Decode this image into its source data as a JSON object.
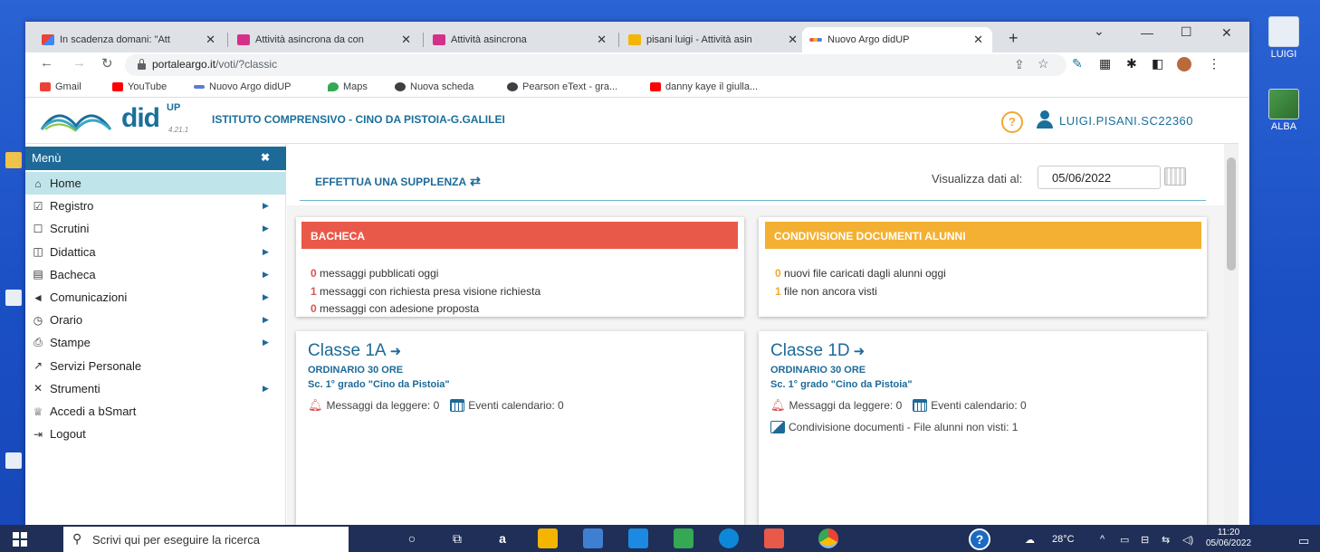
{
  "desktop": {
    "icons": [
      {
        "label": "LUIGI"
      },
      {
        "label": "ALBA"
      }
    ]
  },
  "browser": {
    "tabs": [
      {
        "title": "In scadenza domani: \"Att",
        "favicon_color": "#ea4335"
      },
      {
        "title": "Attività asincrona da con",
        "favicon_color": "#d62f8a"
      },
      {
        "title": "Attività asincrona",
        "favicon_color": "#d62f8a"
      },
      {
        "title": "pisani luigi - Attività asin",
        "favicon_color": "#f4b400"
      },
      {
        "title": "Nuovo Argo didUP",
        "favicon_color": "#5b7bd5",
        "active": true
      }
    ],
    "new_tab": "+",
    "url_host": "portaleargo.it",
    "url_path": "/voti/?classic",
    "bookmarks": [
      {
        "label": "Gmail",
        "color": "#ea4335"
      },
      {
        "label": "YouTube",
        "color": "#ff0000"
      },
      {
        "label": "Nuovo Argo didUP",
        "color": "#5b7bd5"
      },
      {
        "label": "Maps",
        "color": "#34a853"
      },
      {
        "label": "Nuova scheda",
        "color": "#3c4043"
      },
      {
        "label": "Pearson eText - gra...",
        "color": "#3c4043"
      },
      {
        "label": "danny kaye il giulla...",
        "color": "#ff0000"
      }
    ]
  },
  "app": {
    "brand": "did",
    "brand_sup": "UP",
    "version": "4.21.1",
    "school": "ISTITUTO COMPRENSIVO - CINO DA PISTOIA-G.GALILEI",
    "help": "?",
    "username": "LUIGI.PISANI.SC22360"
  },
  "sidebar": {
    "title": "Menù",
    "close": "✖",
    "items": [
      {
        "label": "Home",
        "icon": "home-icon",
        "glyph": "⌂",
        "active": true,
        "has_arrow": false
      },
      {
        "label": "Registro",
        "icon": "calendar-check-icon",
        "glyph": "☑",
        "has_arrow": true
      },
      {
        "label": "Scrutini",
        "icon": "edit-square-icon",
        "glyph": "☐",
        "has_arrow": true
      },
      {
        "label": "Didattica",
        "icon": "book-icon",
        "glyph": "◫",
        "has_arrow": true
      },
      {
        "label": "Bacheca",
        "icon": "newspaper-icon",
        "glyph": "▤",
        "has_arrow": true
      },
      {
        "label": "Comunicazioni",
        "icon": "megaphone-icon",
        "glyph": "◄",
        "has_arrow": true
      },
      {
        "label": "Orario",
        "icon": "clock-icon",
        "glyph": "◷",
        "has_arrow": true
      },
      {
        "label": "Stampe",
        "icon": "print-icon",
        "glyph": "⎙",
        "has_arrow": true
      },
      {
        "label": "Servizi Personale",
        "icon": "share-icon",
        "glyph": "↗",
        "has_arrow": false
      },
      {
        "label": "Strumenti",
        "icon": "tools-icon",
        "glyph": "✕",
        "has_arrow": true
      },
      {
        "label": "Accedi a bSmart",
        "icon": "graduation-cap-icon",
        "glyph": "♕",
        "has_arrow": false
      },
      {
        "label": "Logout",
        "icon": "logout-icon",
        "glyph": "⇥",
        "has_arrow": false
      }
    ]
  },
  "main": {
    "supplenza": "EFFETTUA UNA SUPPLENZA",
    "date_label": "Visualizza dati al:",
    "date_value": "05/06/2022",
    "bacheca": {
      "title": "BACHECA",
      "color": "#e8594a",
      "lines": [
        {
          "count": "0",
          "text": " messaggi pubblicati oggi"
        },
        {
          "count": "1",
          "text": " messaggi con richiesta presa visione richiesta"
        },
        {
          "count": "0",
          "text": " messaggi con adesione proposta"
        }
      ]
    },
    "condivisione": {
      "title": "CONDIVISIONE DOCUMENTI ALUNNI",
      "color": "#f4b032",
      "lines": [
        {
          "count": "0",
          "text": " nuovi file caricati dagli alunni oggi"
        },
        {
          "count": "1",
          "text": " file non ancora visti"
        }
      ]
    },
    "classes": [
      {
        "title": "Classe 1A",
        "type": "ORDINARIO 30 ORE",
        "school": "Sc. 1° grado \"Cino da Pistoia\"",
        "messages": "Messaggi da leggere: 0",
        "events": "Eventi calendario: 0",
        "files": ""
      },
      {
        "title": "Classe 1D",
        "type": "ORDINARIO 30 ORE",
        "school": "Sc. 1° grado \"Cino da Pistoia\"",
        "messages": "Messaggi da leggere: 0",
        "events": "Eventi calendario: 0",
        "files": "Condivisione documenti - File alunni non visti: 1"
      }
    ]
  },
  "taskbar": {
    "search_placeholder": "Scrivi qui per eseguire la ricerca",
    "weather": "28°C",
    "time": "11:20",
    "date": "05/06/2022"
  }
}
